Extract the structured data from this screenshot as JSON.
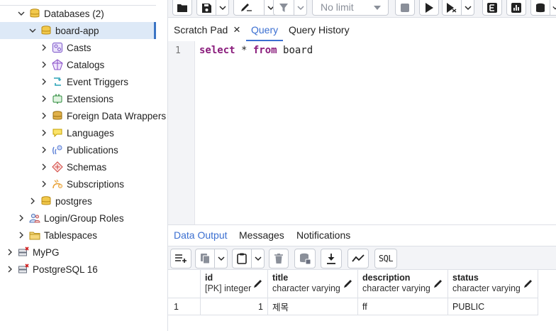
{
  "tree": {
    "databases_label": "Databases (2)",
    "board_app_label": "board-app",
    "children": {
      "casts": "Casts",
      "catalogs": "Catalogs",
      "event_triggers": "Event Triggers",
      "extensions": "Extensions",
      "fdw": "Foreign Data Wrappers",
      "languages": "Languages",
      "publications": "Publications",
      "schemas": "Schemas",
      "subscriptions": "Subscriptions"
    },
    "postgres_label": "postgres",
    "login_roles_label": "Login/Group Roles",
    "tablespaces_label": "Tablespaces",
    "server_mypg": "MyPG",
    "server_pg16": "PostgreSQL 16"
  },
  "toolbar": {
    "limit_value": "No limit"
  },
  "query_tabs": {
    "scratch": "Scratch Pad",
    "close_glyph": "×",
    "query": "Query",
    "history": "Query History"
  },
  "editor": {
    "line_number": "1",
    "kw1": "select",
    "star": " * ",
    "kw2": "from",
    "table": " board"
  },
  "output_tabs": {
    "data_output": "Data Output",
    "messages": "Messages",
    "notifications": "Notifications"
  },
  "output_toolbar": {
    "sql_label": "SQL"
  },
  "grid": {
    "columns": [
      {
        "name": "id",
        "type": "[PK] integer"
      },
      {
        "name": "title",
        "type": "character varying"
      },
      {
        "name": "description",
        "type": "character varying"
      },
      {
        "name": "status",
        "type": "character varying"
      }
    ],
    "rows": [
      {
        "rownum": "1",
        "id": "1",
        "title": "제목",
        "description": "ff",
        "status": "PUBLIC"
      }
    ]
  },
  "colors": {
    "accent": "#3b6fd1",
    "selected_bg": "#dde9f7",
    "keyword": "#8a1c7c",
    "toolbar_bg": "#f3f4f7"
  }
}
